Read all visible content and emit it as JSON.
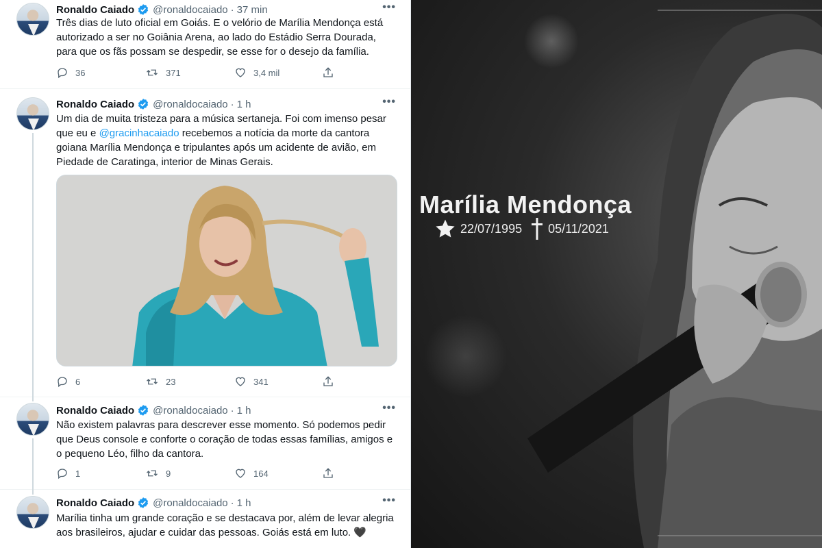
{
  "tweets": [
    {
      "name": "Ronaldo Caiado",
      "handle": "@ronaldocaiado",
      "time": "37 min",
      "text": "Três dias de luto oficial em Goiás. E o velório de Marília Mendonça está autorizado a ser no Goiânia Arena, ao lado do Estádio Serra Dourada, para que os fãs possam se despedir, se esse for o desejo da família.",
      "replies": "36",
      "retweets": "371",
      "likes": "3,4 mil"
    },
    {
      "name": "Ronaldo Caiado",
      "handle": "@ronaldocaiado",
      "time": "1 h",
      "text_before": "Um dia de muita tristeza para a música sertaneja. Foi com imenso pesar que eu e ",
      "mention": "@gracinhacaiado",
      "text_after": " recebemos a notícia da morte da cantora goiana Marília Mendonça e tripulantes após um acidente de avião, em Piedade de Caratinga, interior de Minas Gerais.",
      "replies": "6",
      "retweets": "23",
      "likes": "341"
    },
    {
      "name": "Ronaldo Caiado",
      "handle": "@ronaldocaiado",
      "time": "1 h",
      "text": "Não existem palavras para descrever esse momento. Só podemos pedir que Deus console e conforte o coração de todas essas famílias, amigos e o pequeno Léo, filho da cantora.",
      "replies": "1",
      "retweets": "9",
      "likes": "164"
    },
    {
      "name": "Ronaldo Caiado",
      "handle": "@ronaldocaiado",
      "time": "1 h",
      "text": "Marília tinha um grande coração e se destacava por, além de levar alegria aos brasileiros, ajudar e cuidar das pessoas. Goiás está em luto. 🖤"
    }
  ],
  "separator": "·",
  "memorial": {
    "name": "Marília Mendonça",
    "born": "22/07/1995",
    "died": "05/11/2021"
  },
  "icons": {
    "verified": "verified-badge-icon",
    "more": "more-options-icon",
    "reply": "reply-icon",
    "retweet": "retweet-icon",
    "like": "heart-icon",
    "share": "share-icon",
    "star": "star-icon",
    "cross": "cross-icon"
  },
  "colors": {
    "accent": "#1d9bf0",
    "muted": "#536471",
    "text": "#0f1419"
  }
}
